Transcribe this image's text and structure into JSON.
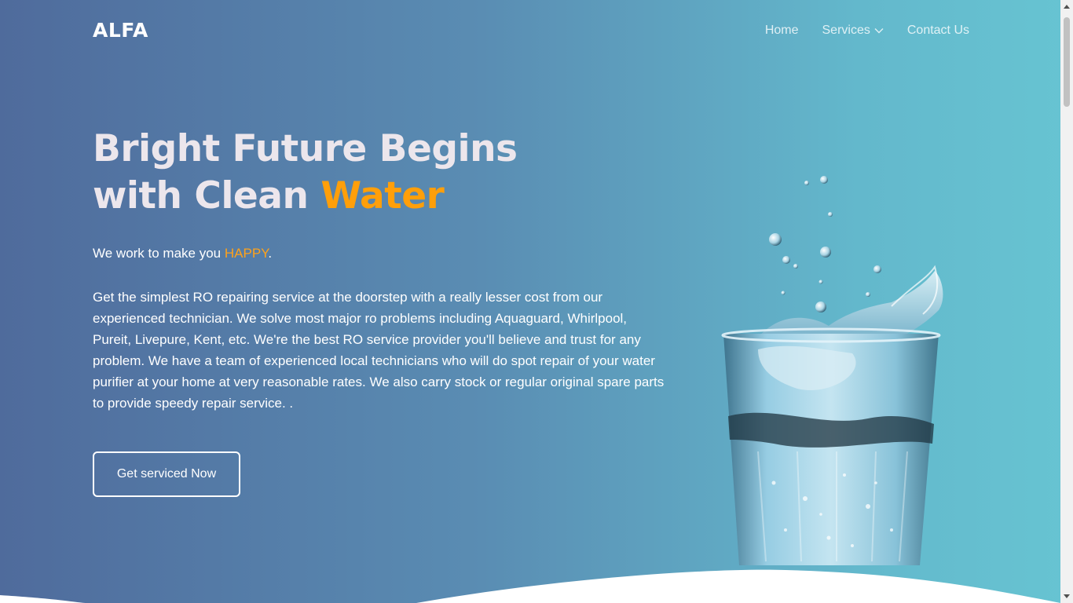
{
  "header": {
    "logo": "ALFA",
    "nav": {
      "home": "Home",
      "services": "Services",
      "contact": "Contact Us"
    }
  },
  "hero": {
    "title_line1": "Bright Future Begins",
    "title_line2_prefix": "with Clean ",
    "title_line2_accent": "Water",
    "tagline_prefix": "We work to make you ",
    "tagline_accent": "HAPPY",
    "tagline_suffix": ".",
    "description": "Get the simplest RO repairing service at the doorstep with a really lesser cost from our experienced technician. We solve most major ro problems including Aquaguard, Whirlpool, Pureit, Livepure, Kent, etc. We're the best RO service provider you'll believe and trust for any problem. We have a team of experienced local technicians who will do spot repair of your water purifier at your home at very reasonable rates. We also carry stock or regular original spare parts to provide speedy repair service. .",
    "cta_label": "Get serviced Now"
  },
  "colors": {
    "gradient_start": "#4f6b9c",
    "gradient_end": "#67c4d2",
    "accent": "#ff9f0a",
    "title_text": "#ece6ec"
  },
  "icons": {
    "dropdown": "chevron-down-icon",
    "illustration": "water-glass-icon"
  }
}
